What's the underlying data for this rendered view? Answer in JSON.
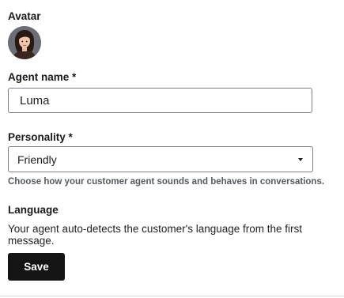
{
  "avatar": {
    "label": "Avatar",
    "icon": "woman-avatar-illustration"
  },
  "agent_name": {
    "label": "Agent name *",
    "value": "Luma"
  },
  "personality": {
    "label": "Personality *",
    "selected": "Friendly",
    "help": "Choose how your customer agent sounds and behaves in conversations."
  },
  "language": {
    "label": "Language",
    "description": "Your agent auto-detects the customer's language from the first message."
  },
  "actions": {
    "save_label": "Save"
  },
  "colors": {
    "primary_button": "#141414",
    "border": "#7c8088",
    "help_text": "#555a61"
  }
}
